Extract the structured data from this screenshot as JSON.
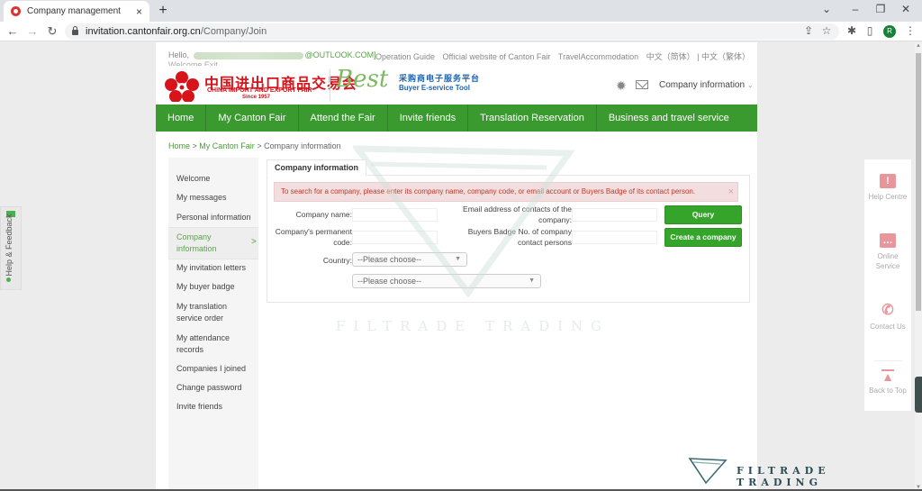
{
  "browser": {
    "tab_title": "Company management",
    "tab_close": "×",
    "new_tab": "+",
    "url_host": "invitation.cantonfair.org.cn",
    "url_path": "/Company/Join",
    "profile_initial": "R",
    "icons": [
      "back-icon",
      "forward-icon",
      "reload-icon",
      "lock-icon",
      "share-icon",
      "star-icon",
      "extensions-icon",
      "side-panel-icon",
      "menu-icon"
    ]
  },
  "header": {
    "hello": "Hello,",
    "email_suffix": "@OUTLOOK.COM]",
    "welcome": "Welcome Exit",
    "top_links": [
      "Operation Guide",
      "Official website of Canton Fair",
      "TravelAccommodation",
      "中文（简体）",
      "| 中文（繁体）"
    ],
    "logo_cn": "中国进出口商品交易会",
    "logo_en": "CHINA IMPORT AND EXPORT FAIR",
    "logo_since": "Since 1957",
    "best": "Best",
    "best_cn": "采购商电子服务平台",
    "best_en": "Buyer E-service Tool",
    "company_dropdown": "Company information",
    "colors": {
      "brand_red": "#d8141b",
      "nav_green": "#3b9a2f"
    }
  },
  "nav": {
    "items": [
      "Home",
      "My Canton Fair",
      "Attend the Fair",
      "Invite friends",
      "Translation Reservation",
      "Business and travel service"
    ]
  },
  "breadcrumb": {
    "home": "Home",
    "sep1": " > ",
    "parent": "My Canton Fair",
    "sep2": " > ",
    "current": "Company information"
  },
  "sidebar": {
    "items": [
      {
        "label": "Welcome"
      },
      {
        "label": "My messages"
      },
      {
        "label": "Personal information"
      },
      {
        "label": "Company information",
        "active": true
      },
      {
        "label": "My invitation letters"
      },
      {
        "label": "My buyer badge"
      },
      {
        "label": "My translation service order"
      },
      {
        "label": "My attendance records"
      },
      {
        "label": "Companies I joined"
      },
      {
        "label": "Change password"
      },
      {
        "label": "Invite friends"
      }
    ]
  },
  "content": {
    "tab": "Company information",
    "alert": "To search for a company, please enter its company name, company code, or email account or Buyers Badge of its contact person.",
    "alert_close": "×",
    "form": {
      "company_name_label": "Company name:",
      "company_name_value": "",
      "email_label": "Email address of contacts of the company:",
      "email_value": "",
      "code_label": "Company's permanent code:",
      "code_value": "",
      "badge_label": "Buyers Badge No. of company contact persons",
      "badge_value": "",
      "country_label": "Country:",
      "country_select": "--Please choose--",
      "region_select": "--Please choose--"
    },
    "query_button": "Query",
    "create_button": "Create a company"
  },
  "watermark": "FILTRADE TRADING",
  "right_float": {
    "items": [
      "Help Centre",
      "Online Service",
      "Contact Us",
      "Back to Top"
    ]
  },
  "feedback": "Help & Feedback"
}
